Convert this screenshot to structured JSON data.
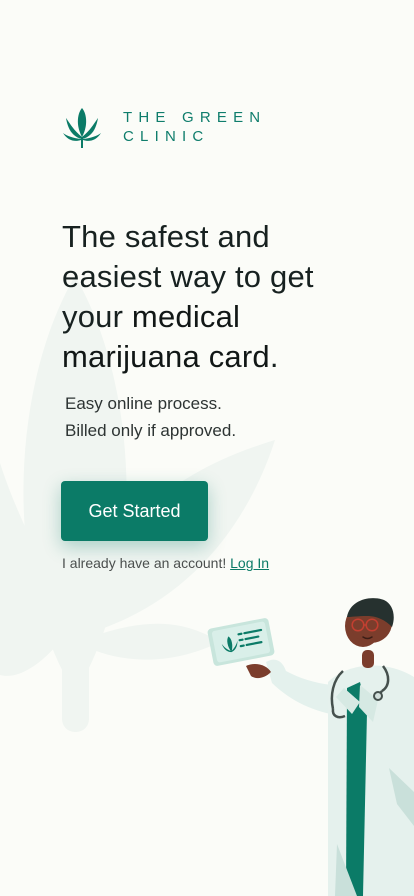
{
  "brand": {
    "line1": "THE GREEN",
    "line2": "CLINIC",
    "logo_icon": "cannabis-leaf-icon",
    "accent_color": "#0b7b67"
  },
  "hero": {
    "line1": "The safest and",
    "line2": "easiest way to get",
    "line3_prefix": "your ",
    "line3_bold": "medical",
    "line4_bold": "marijuana card",
    "line4_suffix": "."
  },
  "subcopy": {
    "line1": "Easy online process.",
    "line2": "Billed only if approved."
  },
  "cta": {
    "label": "Get Started"
  },
  "account": {
    "text": "I already have an account!",
    "link": "Log In"
  },
  "illustration": {
    "name": "doctor-holding-card-illustration"
  }
}
